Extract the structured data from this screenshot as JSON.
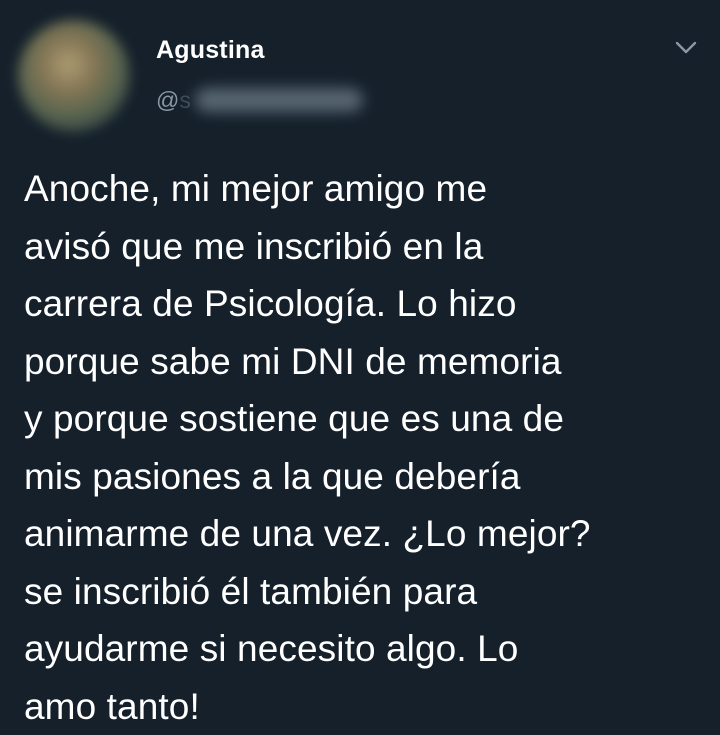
{
  "tweet": {
    "author": {
      "display_name": "Agustina",
      "handle_prefix": "@",
      "handle_visible_fragment": "s"
    },
    "text": "Anoche, mi mejor amigo me\navisó que me inscribió en la\ncarrera de Psicología. Lo hizo\nporque sabe mi DNI de memoria\ny porque sostiene que es una de\nmis pasiones a la que debería\nanimarme de una vez. ¿Lo mejor?\nse inscribió él también para\nayudarme si necesito algo. Lo\namo tanto!",
    "menu_icon": "chevron-down-icon"
  },
  "colors": {
    "background": "#15202b",
    "text": "#ffffff",
    "secondary_text": "#8899a6"
  }
}
